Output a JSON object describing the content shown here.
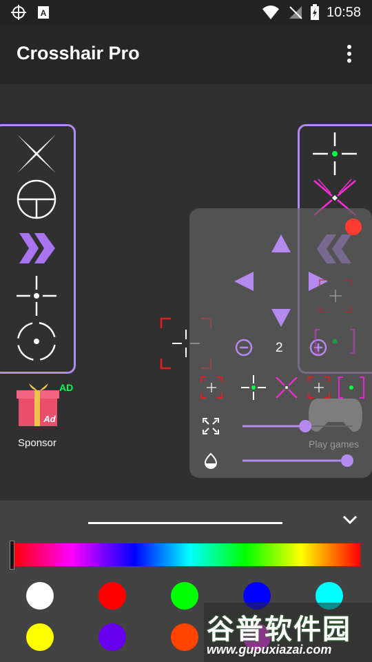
{
  "status_bar": {
    "time": "10:58"
  },
  "app_bar": {
    "title": "Crosshair Pro",
    "menu_icon": "more-vert-icon"
  },
  "crosshair_sidebar_left": [
    "x-cross",
    "scope-circle",
    "chevrons-right",
    "dot-cross",
    "circle-dot"
  ],
  "crosshair_sidebar_right": [
    "green-dot-cross",
    "magenta-x",
    "chevrons-left",
    "red-bracket-small",
    "bracket-green-dot"
  ],
  "sponsor": {
    "badge": "AD",
    "label": "Sponsor",
    "gift_text": "Ad"
  },
  "controls": {
    "size_value": "2",
    "presets": [
      "red-corner-cross",
      "green-dot-cross",
      "magenta-x",
      "red-corner-cross-2",
      "magenta-bracket-dot"
    ],
    "size_slider_fraction": 0.6,
    "opacity_slider_fraction": 1.0,
    "watermark_text": "Play games",
    "accent_color": "#b48aef"
  },
  "color_panel": {
    "swatches_row1": [
      "#ffffff",
      "#ff0000",
      "#00ff00",
      "#0000ff",
      "#00ffff"
    ],
    "swatches_row2": [
      "#ffff00",
      "#6600ee",
      "#ff4400",
      "#ff44ff"
    ]
  },
  "watermark": {
    "cn_text": "谷普软件园",
    "url_text": "www.gupuxiazai.com"
  }
}
